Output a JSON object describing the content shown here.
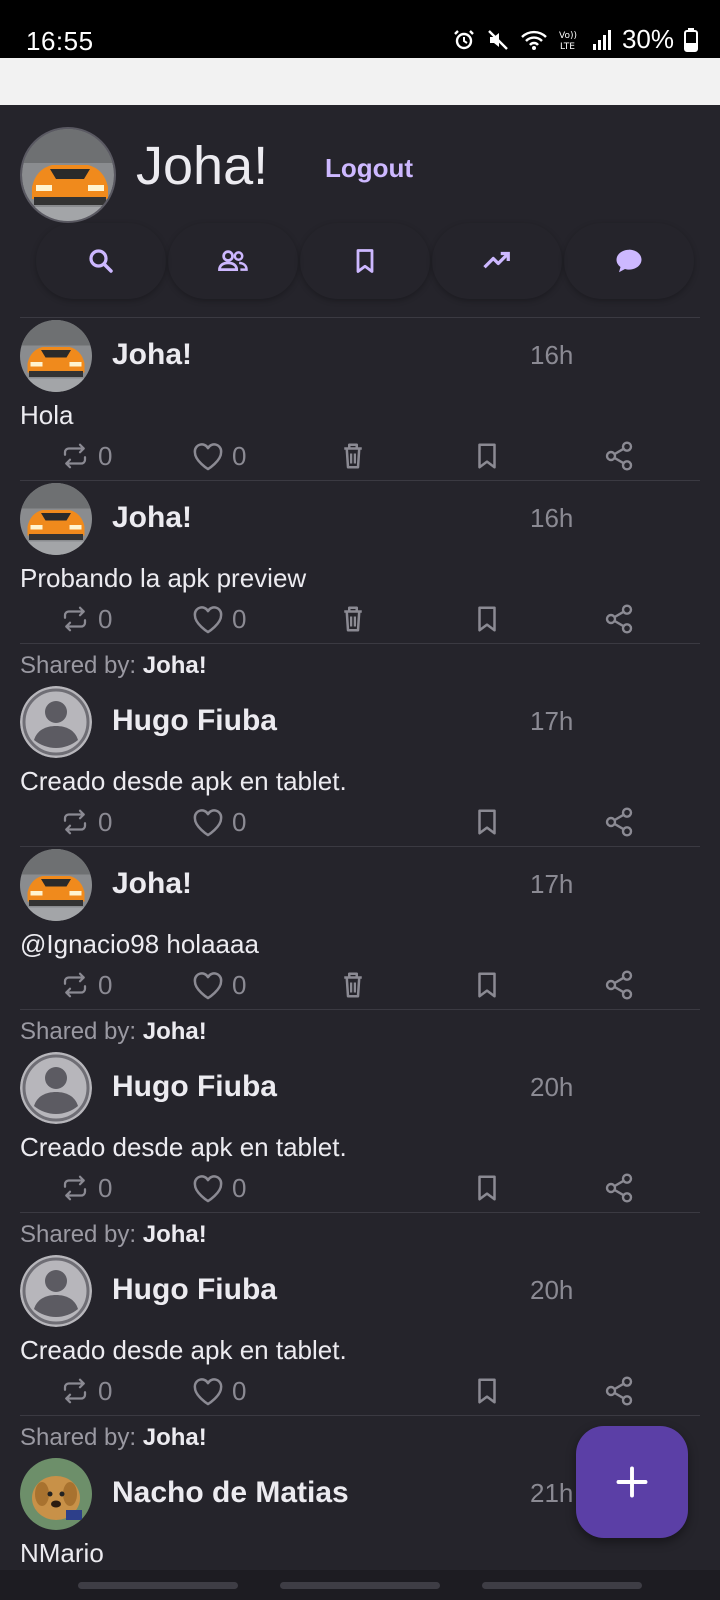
{
  "status_bar": {
    "time": "16:55",
    "battery": "30%"
  },
  "profile": {
    "name": "Joha!",
    "logout_label": "Logout"
  },
  "tabs": [
    {
      "icon": "search-icon"
    },
    {
      "icon": "people-icon"
    },
    {
      "icon": "bookmark-icon"
    },
    {
      "icon": "trending-icon"
    },
    {
      "icon": "chat-icon"
    }
  ],
  "shared_label": "Shared by:",
  "posts": [
    {
      "shared_by": "",
      "author": "Joha!",
      "avatar": "car",
      "time": "16h",
      "text": "Hola",
      "retweets": "0",
      "likes": "0",
      "deletable": true
    },
    {
      "shared_by": "",
      "author": "Joha!",
      "avatar": "car",
      "time": "16h",
      "text": "Probando la apk preview",
      "retweets": "0",
      "likes": "0",
      "deletable": true
    },
    {
      "shared_by": "Joha!",
      "author": "Hugo Fiuba",
      "avatar": "default",
      "time": "17h",
      "text": "Creado desde apk en tablet.",
      "retweets": "0",
      "likes": "0",
      "deletable": false
    },
    {
      "shared_by": "",
      "author": "Joha!",
      "avatar": "car",
      "time": "17h",
      "text": "@Ignacio98 holaaaa",
      "retweets": "0",
      "likes": "0",
      "deletable": true
    },
    {
      "shared_by": "Joha!",
      "author": "Hugo Fiuba",
      "avatar": "default",
      "time": "20h",
      "text": "Creado desde apk en tablet.",
      "retweets": "0",
      "likes": "0",
      "deletable": false
    },
    {
      "shared_by": "Joha!",
      "author": "Hugo Fiuba",
      "avatar": "default",
      "time": "20h",
      "text": "Creado desde apk en tablet.",
      "retweets": "0",
      "likes": "0",
      "deletable": false
    },
    {
      "shared_by": "Joha!",
      "author": "Nacho de Matias",
      "avatar": "dog",
      "time": "21h",
      "text": "NMario",
      "retweets": "",
      "likes": "",
      "deletable": false
    }
  ],
  "fab": {
    "icon": "plus-icon"
  },
  "colors": {
    "background": "#25242b",
    "accent": "#cdb8ff",
    "fab": "#5b3fa6"
  }
}
